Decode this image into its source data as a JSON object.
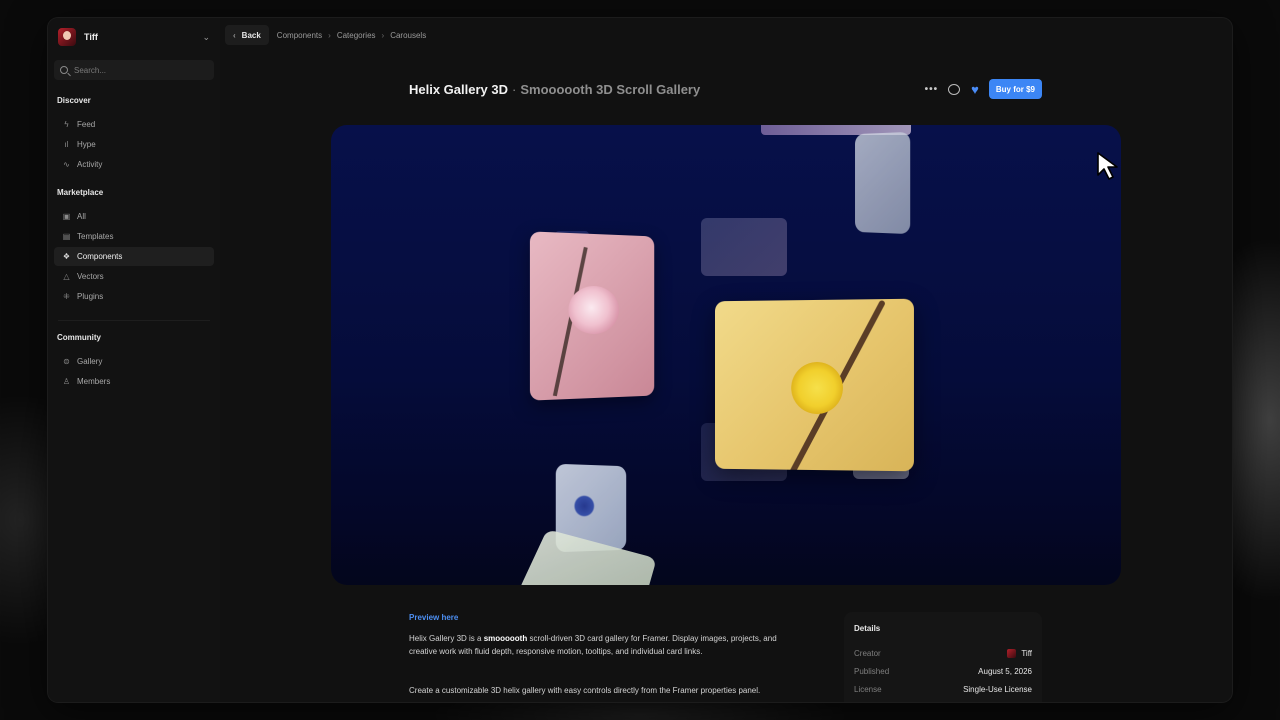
{
  "sidebar": {
    "user_name": "Tiff",
    "search_placeholder": "Search...",
    "sections": [
      {
        "title": "Discover",
        "items": [
          {
            "label": "Feed",
            "icon": "bolt-icon"
          },
          {
            "label": "Hype",
            "icon": "hype-icon"
          },
          {
            "label": "Activity",
            "icon": "activity-icon"
          }
        ]
      },
      {
        "title": "Marketplace",
        "items": [
          {
            "label": "All",
            "icon": "box-icon"
          },
          {
            "label": "Templates",
            "icon": "template-icon"
          },
          {
            "label": "Components",
            "icon": "component-icon",
            "active": true
          },
          {
            "label": "Vectors",
            "icon": "vector-icon"
          },
          {
            "label": "Plugins",
            "icon": "plugin-icon"
          }
        ]
      },
      {
        "title": "Community",
        "items": [
          {
            "label": "Gallery",
            "icon": "gallery-icon"
          },
          {
            "label": "Members",
            "icon": "members-icon"
          }
        ]
      }
    ]
  },
  "topbar": {
    "back_label": "Back",
    "breadcrumbs": [
      "Components",
      "Categories",
      "Carousels"
    ]
  },
  "header": {
    "title": "Helix Gallery 3D",
    "separator": "·",
    "subtitle": "Smoooooth 3D Scroll Gallery",
    "buy_label": "Buy for $9"
  },
  "content": {
    "preview_link": "Preview here",
    "description_1_a": "Helix Gallery 3D is a ",
    "description_1_bold": "smoooooth",
    "description_1_b": " scroll-driven 3D card gallery for Framer. Display images, projects, and creative work with fluid depth, responsive motion, tooltips, and individual card links.",
    "description_2": "Create a customizable 3D helix gallery with easy controls directly from the Framer properties panel."
  },
  "details": {
    "title": "Details",
    "rows": [
      {
        "key": "Creator",
        "value": "Tiff"
      },
      {
        "key": "Published",
        "value": "August 5, 2026"
      },
      {
        "key": "License",
        "value": "Single-Use License"
      }
    ]
  },
  "colors": {
    "accent": "#3c86f5",
    "link": "#4d8ff2",
    "heart": "#4a8cf7",
    "window_bg": "#111111"
  }
}
